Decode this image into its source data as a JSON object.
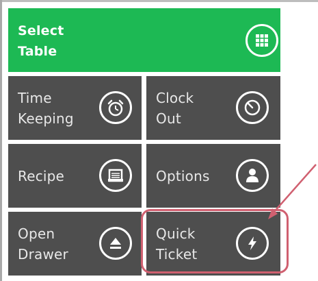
{
  "tiles": {
    "select_table": {
      "label": "Select\nTable",
      "icon": "grid-icon",
      "color": "#1db954"
    },
    "time_keeping": {
      "label": "Time\nKeeping",
      "icon": "alarm-clock-icon"
    },
    "clock_out": {
      "label": "Clock\nOut",
      "icon": "clock-icon"
    },
    "recipe": {
      "label": "Recipe",
      "icon": "recipe-box-icon"
    },
    "options": {
      "label": "Options",
      "icon": "user-icon"
    },
    "open_drawer": {
      "label": "Open\nDrawer",
      "icon": "eject-icon"
    },
    "quick_ticket": {
      "label": "Quick\nTicket",
      "icon": "lightning-icon"
    }
  },
  "colors": {
    "tile_gray": "#4e4e4e",
    "accent_green": "#1db954",
    "annotation_red": "#d06070"
  }
}
